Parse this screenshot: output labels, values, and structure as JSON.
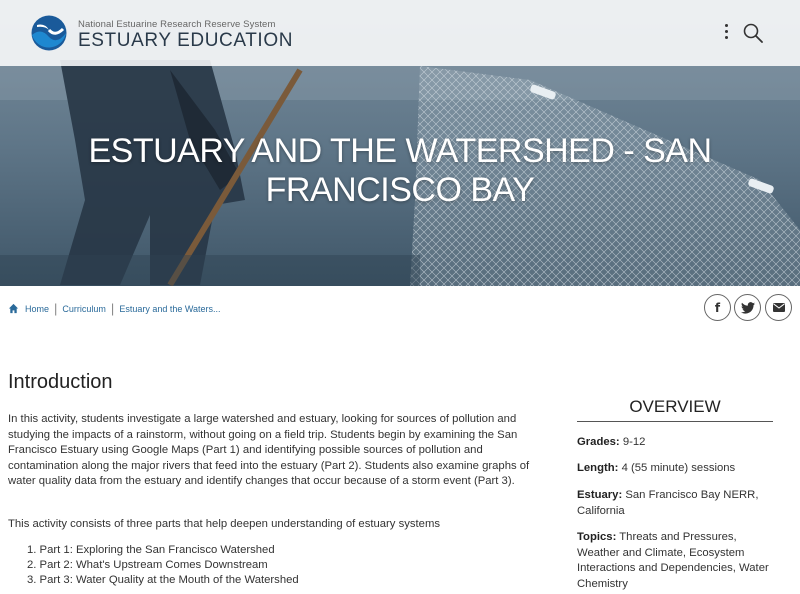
{
  "header": {
    "org_name": "National Estuarine Research Reserve System",
    "site_name": "ESTUARY EDUCATION"
  },
  "hero": {
    "title": "ESTUARY AND THE WATERSHED - SAN FRANCISCO BAY"
  },
  "breadcrumb": {
    "items": [
      "Home",
      "Curriculum",
      "Estuary and the Waters..."
    ]
  },
  "share": {
    "facebook": "f",
    "twitter": "twitter-icon",
    "email": "email-icon"
  },
  "main": {
    "heading": "Introduction",
    "paragraph1": "In this activity, students investigate a large watershed and estuary, looking for sources of pollution and studying the impacts of a rainstorm, without going on a field trip. Students begin by examining the San Francisco Estuary using Google Maps (Part 1) and identifying possible sources of pollution and contamination along the major rivers that feed into the estuary (Part 2). Students also examine graphs of water quality data from the estuary and identify changes that occur because of a storm event (Part 3).",
    "paragraph2": "This activity consists of three parts that help deepen understanding of estuary systems",
    "parts": [
      "1. Part 1: Exploring the San Francisco Watershed",
      "2. Part 2: What's Upstream Comes Downstream",
      "3. Part 3: Water Quality at the Mouth of the Watershed"
    ]
  },
  "overview": {
    "title": "OVERVIEW",
    "grades_label": "Grades:",
    "grades_value": "9-12",
    "length_label": "Length:",
    "length_value": "4 (55 minute) sessions",
    "estuary_label": "Estuary:",
    "estuary_value": "San Francisco Bay NERR, California",
    "topics_label": "Topics:",
    "topics_value": "Threats and Pressures, Weather and Climate, Ecosystem Interactions and Dependencies, Water Chemistry"
  },
  "colors": {
    "link": "#2a6a9a",
    "noaa_blue": "#1a5a9a"
  }
}
